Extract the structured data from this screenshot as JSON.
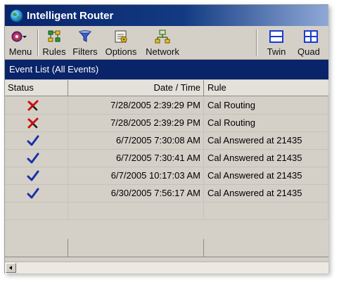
{
  "window": {
    "title": "Intelligent Router"
  },
  "toolbar": {
    "buttons": [
      {
        "label": "Menu",
        "icon": "globe-dropdown-icon"
      },
      {
        "label": "Rules",
        "icon": "rules-icon"
      },
      {
        "label": "Filters",
        "icon": "filter-funnel-icon"
      },
      {
        "label": "Options",
        "icon": "options-icon"
      },
      {
        "label": "Network",
        "icon": "network-icon"
      },
      {
        "label": "Twin",
        "icon": "twin-layout-icon"
      },
      {
        "label": "Quad",
        "icon": "quad-layout-icon"
      }
    ]
  },
  "event_list": {
    "title": "Event List (All Events)",
    "columns": [
      "Status",
      "Date / Time",
      "Rule"
    ],
    "rows": [
      {
        "status": "error",
        "status_icon": "red-x-icon",
        "datetime": "7/28/2005 2:39:29 PM",
        "rule": "Cal Routing"
      },
      {
        "status": "error",
        "status_icon": "red-x-icon",
        "datetime": "7/28/2005 2:39:29 PM",
        "rule": "Cal Routing"
      },
      {
        "status": "ok",
        "status_icon": "blue-check-icon",
        "datetime": "6/7/2005 7:30:08 AM",
        "rule": "Cal Answered at 21435"
      },
      {
        "status": "ok",
        "status_icon": "blue-check-icon",
        "datetime": "6/7/2005 7:30:41 AM",
        "rule": "Cal Answered at 21435"
      },
      {
        "status": "ok",
        "status_icon": "blue-check-icon",
        "datetime": "6/7/2005 10:17:03 AM",
        "rule": "Cal Answered at 21435"
      },
      {
        "status": "ok",
        "status_icon": "blue-check-icon",
        "datetime": "6/30/2005 7:56:17 AM",
        "rule": "Cal Answered at 21435"
      }
    ]
  },
  "colors": {
    "titlebar": "#0a246a",
    "header_bar": "#0a246a",
    "error": "#cc1111",
    "ok": "#1b2fa8"
  }
}
